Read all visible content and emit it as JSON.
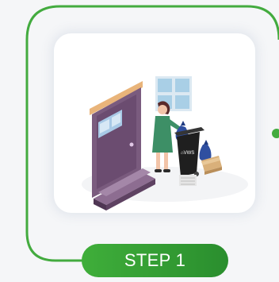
{
  "step": {
    "label": "STEP 1"
  },
  "bin": {
    "logo_text": "⌂VWS"
  },
  "colors": {
    "accent": "#3fae3a",
    "door": "#7a5b7e",
    "bin": "#1f1f1f",
    "bag": "#2f4fa0",
    "dress": "#3d8f66"
  },
  "icons": {
    "illustration": "person-taking-out-trash-illustration"
  }
}
